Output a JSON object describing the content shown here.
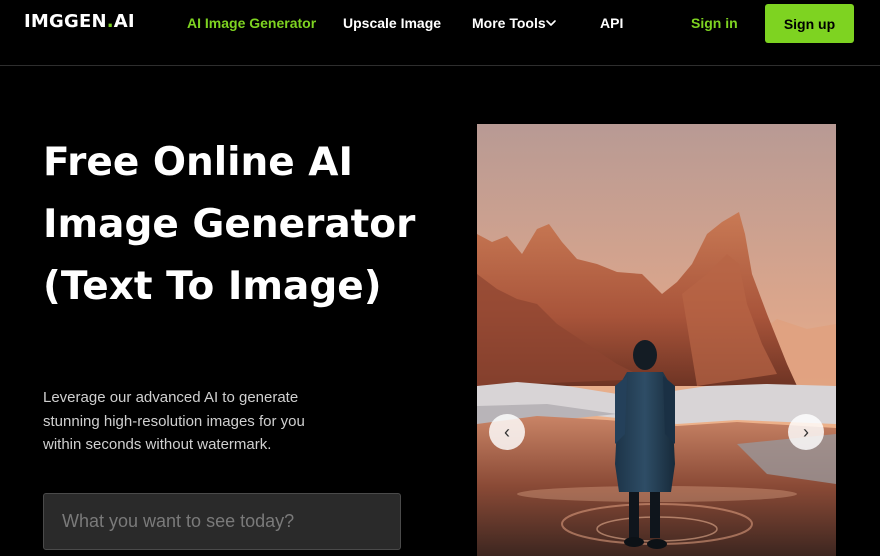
{
  "header": {
    "logo_main": "IMGGEN",
    "logo_dot": ".",
    "logo_suffix": "AI",
    "nav": {
      "ai_image_generator": "AI Image Generator",
      "upscale_image": "Upscale Image",
      "more_tools": "More Tools",
      "api": "API"
    },
    "sign_in": "Sign in",
    "sign_up": "Sign up"
  },
  "hero": {
    "title": "Free Online AI Image Generator (Text To Image)",
    "subtitle": "Leverage our advanced AI to generate stunning high-resolution images for you within seconds without watermark.",
    "prompt_placeholder": "What you want to see today?"
  },
  "carousel": {
    "prev_glyph": "‹",
    "next_glyph": "›"
  },
  "icons": {
    "more_tools_dropdown": "chevron-down-icon",
    "carousel_prev": "chevron-left-icon",
    "carousel_next": "chevron-right-icon"
  },
  "colors": {
    "background": "#000000",
    "accent": "#7ed321",
    "text": "#ffffff",
    "input_bg": "#2a2a2a"
  }
}
